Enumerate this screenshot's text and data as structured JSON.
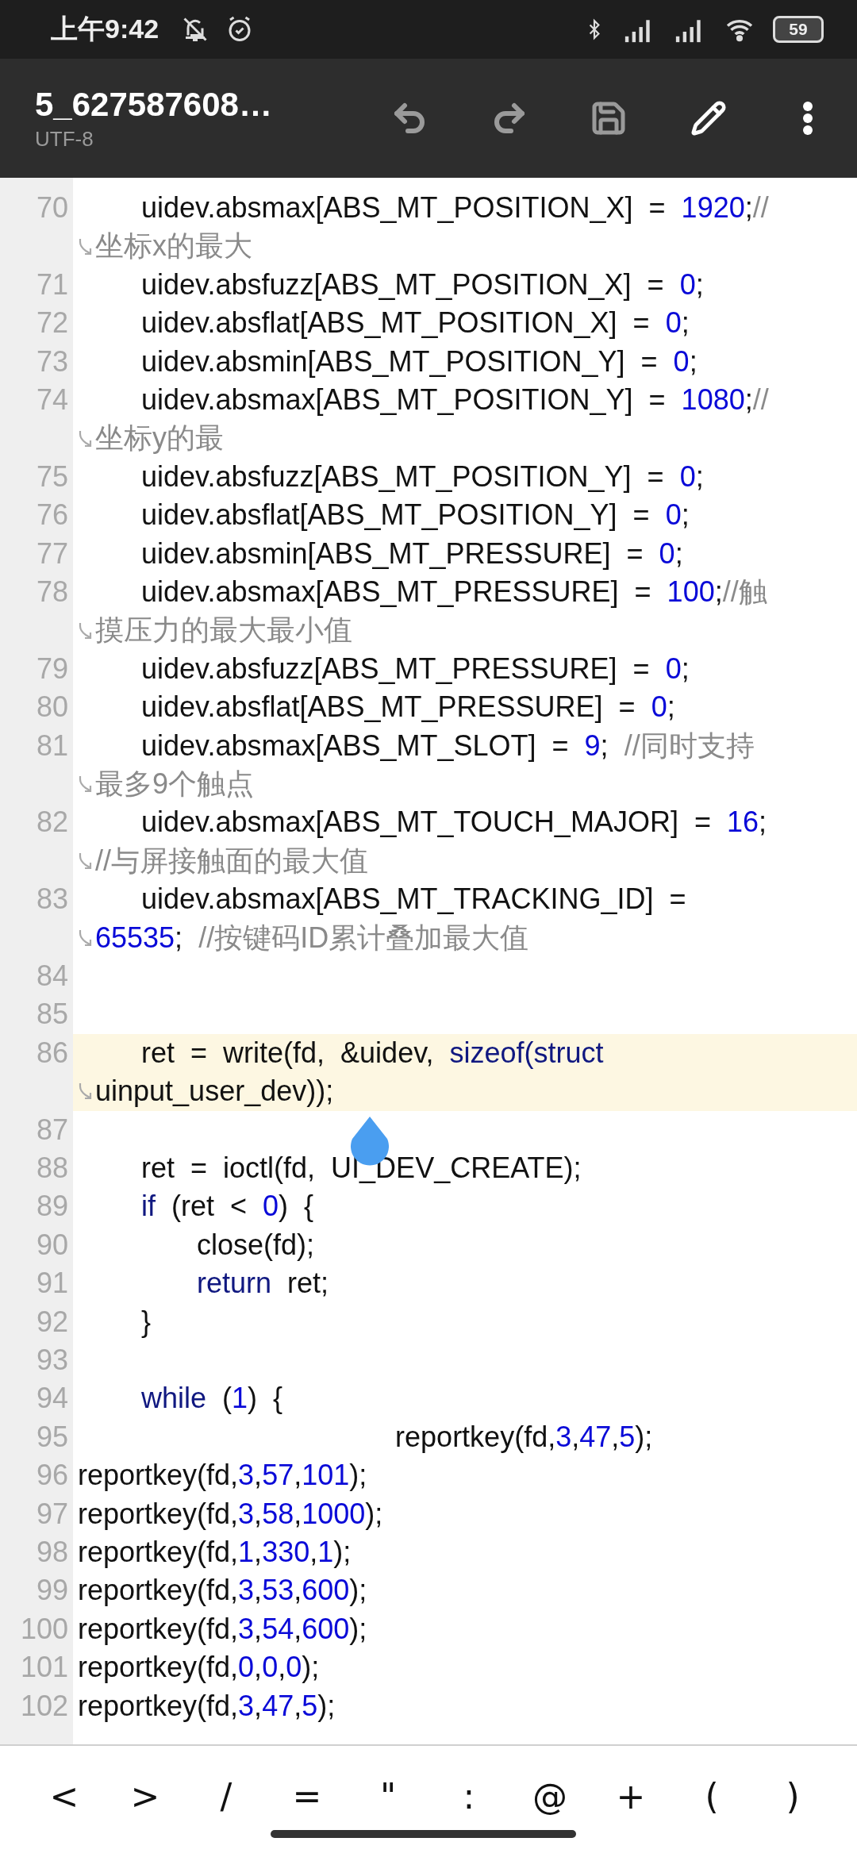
{
  "status_bar": {
    "time": "上午9:42",
    "battery": "59"
  },
  "toolbar": {
    "title": "5_627587608…",
    "subtitle": "UTF-8",
    "actions": [
      {
        "kind": "undo",
        "disabled": true
      },
      {
        "kind": "redo",
        "disabled": true
      },
      {
        "kind": "save",
        "disabled": true
      },
      {
        "kind": "edit",
        "disabled": false
      },
      {
        "kind": "more",
        "disabled": false
      }
    ]
  },
  "editor": {
    "lines": [
      {
        "number": "70",
        "selected": false,
        "rows": [
          [
            {
              "kind": "plain",
              "text": "        uidev.absmax[ABS_MT_POSITION_X]  =  "
            },
            {
              "kind": "num",
              "text": "1920"
            },
            {
              "kind": "plain",
              "text": ";"
            },
            {
              "kind": "comment",
              "text": "//"
            }
          ],
          [
            {
              "kind": "comment",
              "text": "坐标x的最大"
            }
          ]
        ]
      },
      {
        "number": "71",
        "selected": false,
        "rows": [
          [
            {
              "kind": "plain",
              "text": "        uidev.absfuzz[ABS_MT_POSITION_X]  =  "
            },
            {
              "kind": "num",
              "text": "0"
            },
            {
              "kind": "plain",
              "text": ";"
            }
          ]
        ]
      },
      {
        "number": "72",
        "selected": false,
        "rows": [
          [
            {
              "kind": "plain",
              "text": "        uidev.absflat[ABS_MT_POSITION_X]  =  "
            },
            {
              "kind": "num",
              "text": "0"
            },
            {
              "kind": "plain",
              "text": ";"
            }
          ]
        ]
      },
      {
        "number": "73",
        "selected": false,
        "rows": [
          [
            {
              "kind": "plain",
              "text": "        uidev.absmin[ABS_MT_POSITION_Y]  =  "
            },
            {
              "kind": "num",
              "text": "0"
            },
            {
              "kind": "plain",
              "text": ";"
            }
          ]
        ]
      },
      {
        "number": "74",
        "selected": false,
        "rows": [
          [
            {
              "kind": "plain",
              "text": "        uidev.absmax[ABS_MT_POSITION_Y]  =  "
            },
            {
              "kind": "num",
              "text": "1080"
            },
            {
              "kind": "plain",
              "text": ";"
            },
            {
              "kind": "comment",
              "text": "//"
            }
          ],
          [
            {
              "kind": "comment",
              "text": "坐标y的最"
            }
          ]
        ]
      },
      {
        "number": "75",
        "selected": false,
        "rows": [
          [
            {
              "kind": "plain",
              "text": "        uidev.absfuzz[ABS_MT_POSITION_Y]  =  "
            },
            {
              "kind": "num",
              "text": "0"
            },
            {
              "kind": "plain",
              "text": ";"
            }
          ]
        ]
      },
      {
        "number": "76",
        "selected": false,
        "rows": [
          [
            {
              "kind": "plain",
              "text": "        uidev.absflat[ABS_MT_POSITION_Y]  =  "
            },
            {
              "kind": "num",
              "text": "0"
            },
            {
              "kind": "plain",
              "text": ";"
            }
          ]
        ]
      },
      {
        "number": "77",
        "selected": false,
        "rows": [
          [
            {
              "kind": "plain",
              "text": "        uidev.absmin[ABS_MT_PRESSURE]  =  "
            },
            {
              "kind": "num",
              "text": "0"
            },
            {
              "kind": "plain",
              "text": ";"
            }
          ]
        ]
      },
      {
        "number": "78",
        "selected": false,
        "rows": [
          [
            {
              "kind": "plain",
              "text": "        uidev.absmax[ABS_MT_PRESSURE]  =  "
            },
            {
              "kind": "num",
              "text": "100"
            },
            {
              "kind": "plain",
              "text": ";"
            },
            {
              "kind": "comment",
              "text": "//触"
            }
          ],
          [
            {
              "kind": "comment",
              "text": "摸压力的最大最小值"
            }
          ]
        ]
      },
      {
        "number": "79",
        "selected": false,
        "rows": [
          [
            {
              "kind": "plain",
              "text": "        uidev.absfuzz[ABS_MT_PRESSURE]  =  "
            },
            {
              "kind": "num",
              "text": "0"
            },
            {
              "kind": "plain",
              "text": ";"
            }
          ]
        ]
      },
      {
        "number": "80",
        "selected": false,
        "rows": [
          [
            {
              "kind": "plain",
              "text": "        uidev.absflat[ABS_MT_PRESSURE]  =  "
            },
            {
              "kind": "num",
              "text": "0"
            },
            {
              "kind": "plain",
              "text": ";"
            }
          ]
        ]
      },
      {
        "number": "81",
        "selected": false,
        "rows": [
          [
            {
              "kind": "plain",
              "text": "        uidev.absmax[ABS_MT_SLOT]  =  "
            },
            {
              "kind": "num",
              "text": "9"
            },
            {
              "kind": "plain",
              "text": ";  "
            },
            {
              "kind": "comment",
              "text": "//同时支持"
            }
          ],
          [
            {
              "kind": "comment",
              "text": "最多9个触点"
            }
          ]
        ]
      },
      {
        "number": "82",
        "selected": false,
        "rows": [
          [
            {
              "kind": "plain",
              "text": "        uidev.absmax[ABS_MT_TOUCH_MAJOR]  =  "
            },
            {
              "kind": "num",
              "text": "16"
            },
            {
              "kind": "plain",
              "text": ";"
            }
          ],
          [
            {
              "kind": "comment",
              "text": "//与屏接触面的最大值"
            }
          ]
        ]
      },
      {
        "number": "83",
        "selected": false,
        "rows": [
          [
            {
              "kind": "plain",
              "text": "        uidev.absmax[ABS_MT_TRACKING_ID]  ="
            }
          ],
          [
            {
              "kind": "num",
              "text": "65535"
            },
            {
              "kind": "plain",
              "text": ";  "
            },
            {
              "kind": "comment",
              "text": "//按键码ID累计叠加最大值"
            }
          ]
        ]
      },
      {
        "number": "84",
        "selected": false,
        "rows": [
          []
        ]
      },
      {
        "number": "85",
        "selected": false,
        "rows": [
          []
        ]
      },
      {
        "number": "86",
        "selected": true,
        "rows": [
          [
            {
              "kind": "plain",
              "text": "        ret  =  write(fd,  &uidev,  "
            },
            {
              "kind": "kw",
              "text": "sizeof(struct"
            }
          ],
          [
            {
              "kind": "plain",
              "text": "uinput_user_dev));"
            }
          ]
        ]
      },
      {
        "number": "87",
        "selected": false,
        "rows": [
          []
        ]
      },
      {
        "number": "88",
        "selected": false,
        "rows": [
          [
            {
              "kind": "plain",
              "text": "        ret  =  ioctl(fd,  UI_DEV_CREATE);"
            }
          ]
        ]
      },
      {
        "number": "89",
        "selected": false,
        "rows": [
          [
            {
              "kind": "plain",
              "text": "        "
            },
            {
              "kind": "kw",
              "text": "if"
            },
            {
              "kind": "plain",
              "text": "  (ret  <  "
            },
            {
              "kind": "num",
              "text": "0"
            },
            {
              "kind": "plain",
              "text": ")  {"
            }
          ]
        ]
      },
      {
        "number": "90",
        "selected": false,
        "rows": [
          [
            {
              "kind": "plain",
              "text": "               close(fd);"
            }
          ]
        ]
      },
      {
        "number": "91",
        "selected": false,
        "rows": [
          [
            {
              "kind": "plain",
              "text": "               "
            },
            {
              "kind": "kw",
              "text": "return"
            },
            {
              "kind": "plain",
              "text": "  ret;"
            }
          ]
        ]
      },
      {
        "number": "92",
        "selected": false,
        "rows": [
          [
            {
              "kind": "plain",
              "text": "        }"
            }
          ]
        ]
      },
      {
        "number": "93",
        "selected": false,
        "rows": [
          []
        ]
      },
      {
        "number": "94",
        "selected": false,
        "rows": [
          [
            {
              "kind": "plain",
              "text": "        "
            },
            {
              "kind": "kw",
              "text": "while"
            },
            {
              "kind": "plain",
              "text": "  ("
            },
            {
              "kind": "num",
              "text": "1"
            },
            {
              "kind": "plain",
              "text": ")  {"
            }
          ]
        ]
      },
      {
        "number": "95",
        "selected": false,
        "rows": [
          [
            {
              "kind": "plain",
              "text": "                                        reportkey(fd,"
            },
            {
              "kind": "num",
              "text": "3"
            },
            {
              "kind": "plain",
              "text": ","
            },
            {
              "kind": "num",
              "text": "47"
            },
            {
              "kind": "plain",
              "text": ","
            },
            {
              "kind": "num",
              "text": "5"
            },
            {
              "kind": "plain",
              "text": ");"
            }
          ]
        ]
      },
      {
        "number": "96",
        "selected": false,
        "rows": [
          [
            {
              "kind": "plain",
              "text": "reportkey(fd,"
            },
            {
              "kind": "num",
              "text": "3"
            },
            {
              "kind": "plain",
              "text": ","
            },
            {
              "kind": "num",
              "text": "57"
            },
            {
              "kind": "plain",
              "text": ","
            },
            {
              "kind": "num",
              "text": "101"
            },
            {
              "kind": "plain",
              "text": ");"
            }
          ]
        ]
      },
      {
        "number": "97",
        "selected": false,
        "rows": [
          [
            {
              "kind": "plain",
              "text": "reportkey(fd,"
            },
            {
              "kind": "num",
              "text": "3"
            },
            {
              "kind": "plain",
              "text": ","
            },
            {
              "kind": "num",
              "text": "58"
            },
            {
              "kind": "plain",
              "text": ","
            },
            {
              "kind": "num",
              "text": "1000"
            },
            {
              "kind": "plain",
              "text": ");"
            }
          ]
        ]
      },
      {
        "number": "98",
        "selected": false,
        "rows": [
          [
            {
              "kind": "plain",
              "text": "reportkey(fd,"
            },
            {
              "kind": "num",
              "text": "1"
            },
            {
              "kind": "plain",
              "text": ","
            },
            {
              "kind": "num",
              "text": "330"
            },
            {
              "kind": "plain",
              "text": ","
            },
            {
              "kind": "num",
              "text": "1"
            },
            {
              "kind": "plain",
              "text": ");"
            }
          ]
        ]
      },
      {
        "number": "99",
        "selected": false,
        "rows": [
          [
            {
              "kind": "plain",
              "text": "reportkey(fd,"
            },
            {
              "kind": "num",
              "text": "3"
            },
            {
              "kind": "plain",
              "text": ","
            },
            {
              "kind": "num",
              "text": "53"
            },
            {
              "kind": "plain",
              "text": ","
            },
            {
              "kind": "num",
              "text": "600"
            },
            {
              "kind": "plain",
              "text": ");"
            }
          ]
        ]
      },
      {
        "number": "100",
        "selected": false,
        "rows": [
          [
            {
              "kind": "plain",
              "text": "reportkey(fd,"
            },
            {
              "kind": "num",
              "text": "3"
            },
            {
              "kind": "plain",
              "text": ","
            },
            {
              "kind": "num",
              "text": "54"
            },
            {
              "kind": "plain",
              "text": ","
            },
            {
              "kind": "num",
              "text": "600"
            },
            {
              "kind": "plain",
              "text": ");"
            }
          ]
        ]
      },
      {
        "number": "101",
        "selected": false,
        "rows": [
          [
            {
              "kind": "plain",
              "text": "reportkey(fd,"
            },
            {
              "kind": "num",
              "text": "0"
            },
            {
              "kind": "plain",
              "text": ","
            },
            {
              "kind": "num",
              "text": "0"
            },
            {
              "kind": "plain",
              "text": ","
            },
            {
              "kind": "num",
              "text": "0"
            },
            {
              "kind": "plain",
              "text": ");"
            }
          ]
        ]
      },
      {
        "number": "102",
        "selected": false,
        "rows": [
          [
            {
              "kind": "plain",
              "text": "reportkey(fd,"
            },
            {
              "kind": "num",
              "text": "3"
            },
            {
              "kind": "plain",
              "text": ","
            },
            {
              "kind": "num",
              "text": "47"
            },
            {
              "kind": "plain",
              "text": ","
            },
            {
              "kind": "num",
              "text": "5"
            },
            {
              "kind": "plain",
              "text": ");"
            }
          ]
        ]
      }
    ]
  },
  "symbol_bar": {
    "keys": [
      "<",
      ">",
      "/",
      "=",
      "\"",
      ":",
      "@",
      "+",
      "(",
      ")"
    ]
  }
}
